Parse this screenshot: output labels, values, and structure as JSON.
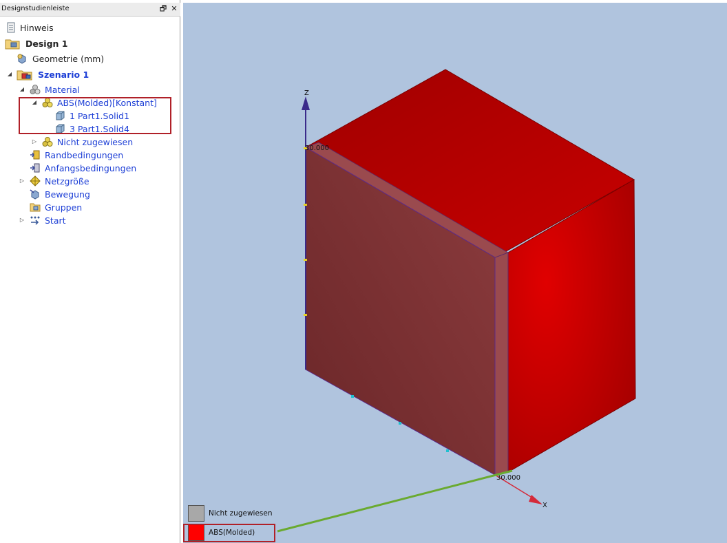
{
  "panel": {
    "title": "Designstudienleiste",
    "restore_button": "🗗",
    "close_button": "✕"
  },
  "tree": {
    "hinweis": "Hinweis",
    "design": "Design 1",
    "geometrie": "Geometrie (mm)",
    "szenario": "Szenario 1",
    "material": "Material",
    "abs": "ABS(Molded)[Konstant]",
    "solid1": "1 Part1.Solid1",
    "solid4": "3 Part1.Solid4",
    "nicht_zugewiesen": "Nicht zugewiesen",
    "randbedingungen": "Randbedingungen",
    "anfangsbedingungen": "Anfangsbedingungen",
    "netzgroesse": "Netzgröße",
    "bewegung": "Bewegung",
    "gruppen": "Gruppen",
    "start": "Start"
  },
  "viewport": {
    "axis_z": "Z",
    "axis_x": "X",
    "dim_top": "30.000",
    "dim_bottom": "30.000",
    "colors": {
      "background": "#b0c4de",
      "solid_red": "#cc0000",
      "front_face": "#7a2e30",
      "axis_z": "#3a2a8a",
      "axis_x": "#d42a3a",
      "callout_line": "#6aaa30"
    }
  },
  "legend": {
    "items": [
      {
        "label": "Nicht zugewiesen",
        "color": "#a8a8a8"
      },
      {
        "label": "ABS(Molded)",
        "color": "#ff0000"
      }
    ]
  },
  "icons": {
    "hinweis": "note-icon",
    "design": "design-folder-icon",
    "geometrie": "geometry-icon",
    "szenario": "scenario-icon",
    "material": "material-icon",
    "solid": "solid-part-icon",
    "randbedingungen": "boundary-conditions-icon",
    "anfangsbedingungen": "initial-conditions-icon",
    "netzgroesse": "mesh-size-icon",
    "bewegung": "motion-icon",
    "gruppen": "groups-icon",
    "start": "run-icon"
  }
}
